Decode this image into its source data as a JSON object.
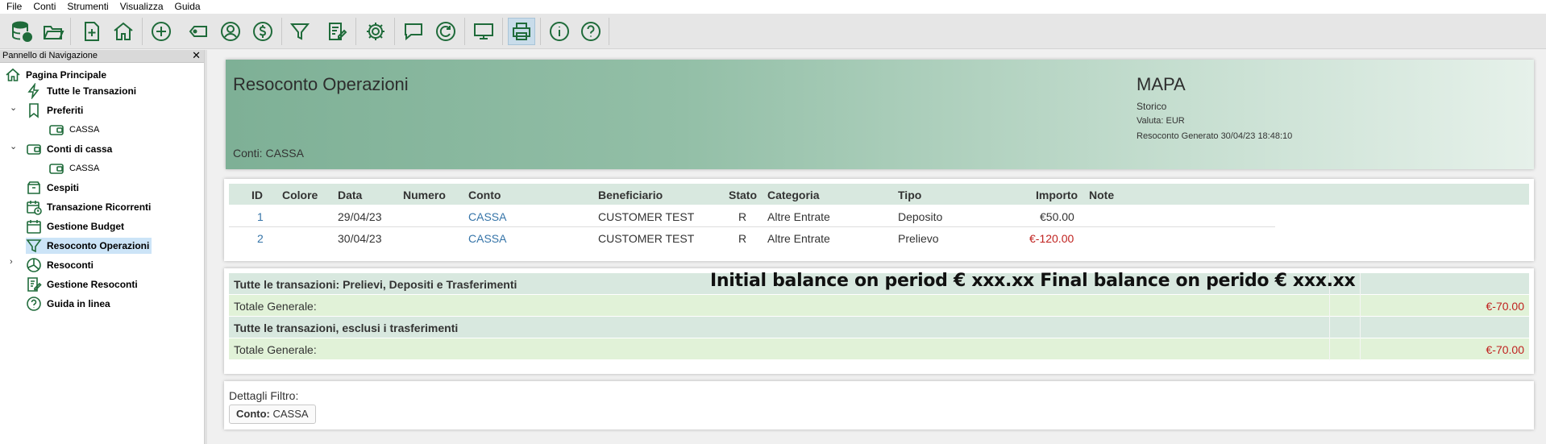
{
  "menu": [
    "File",
    "Conti",
    "Strumenti",
    "Visualizza",
    "Guida"
  ],
  "toolbar_icons": [
    "database-icon",
    "folder-open-icon",
    "new-file-icon",
    "home-icon",
    "add-icon",
    "tag-icon",
    "user-icon",
    "dollar-icon",
    "filter-icon",
    "edit-report-icon",
    "settings-icon",
    "comment-icon",
    "refresh-icon",
    "monitor-icon",
    "print-icon",
    "info-icon",
    "help-icon"
  ],
  "nav": {
    "header": "Pannello di Navigazione",
    "close": "✕",
    "items": [
      {
        "label": "Pagina Principale"
      },
      {
        "label": "Tutte le Transazioni"
      },
      {
        "label": "Preferiti"
      },
      {
        "label": "CASSA"
      },
      {
        "label": "Conti di cassa"
      },
      {
        "label": "CASSA"
      },
      {
        "label": "Cespiti"
      },
      {
        "label": "Transazione Ricorrenti"
      },
      {
        "label": "Gestione Budget"
      },
      {
        "label": "Resoconto Operazioni"
      },
      {
        "label": "Resoconti"
      },
      {
        "label": "Gestione Resoconti"
      },
      {
        "label": "Guida in linea"
      }
    ]
  },
  "report": {
    "title": "Resoconto Operazioni",
    "conti": "Conti: CASSA",
    "org": "MAPA",
    "storico": "Storico",
    "valuta": "Valuta: EUR",
    "generated": "Resoconto Generato 30/04/23 18:48:10"
  },
  "table": {
    "headers": [
      "ID",
      "Colore",
      "Data",
      "Numero",
      "Conto",
      "Beneficiario",
      "Stato",
      "Categoria",
      "Tipo",
      "Importo",
      "Note"
    ],
    "rows": [
      {
        "id": "1",
        "data": "29/04/23",
        "conto": "CASSA",
        "beneficiario": "CUSTOMER TEST",
        "stato": "R",
        "categoria": "Altre Entrate",
        "tipo": "Deposito",
        "importo": "€50.00"
      },
      {
        "id": "2",
        "data": "30/04/23",
        "conto": "CASSA",
        "beneficiario": "CUSTOMER TEST",
        "stato": "R",
        "categoria": "Altre Entrate",
        "tipo": "Prelievo",
        "importo": "€-120.00"
      }
    ]
  },
  "totals": {
    "group1_title": "Tutte le transazioni: Prelievi, Depositi e Trasferimenti",
    "group1_label": "Totale Generale:",
    "group1_amount": "€-70.00",
    "group2_title": "Tutte le transazioni, esclusi i trasferimenti",
    "group2_label": "Totale Generale:",
    "group2_amount": "€-70.00",
    "overlay_text": "Initial balance on period € xxx.xx Final balance on perido € xxx.xx"
  },
  "filter": {
    "label": "Dettagli Filtro:",
    "chip_key": "Conto:",
    "chip_value": "CASSA"
  }
}
